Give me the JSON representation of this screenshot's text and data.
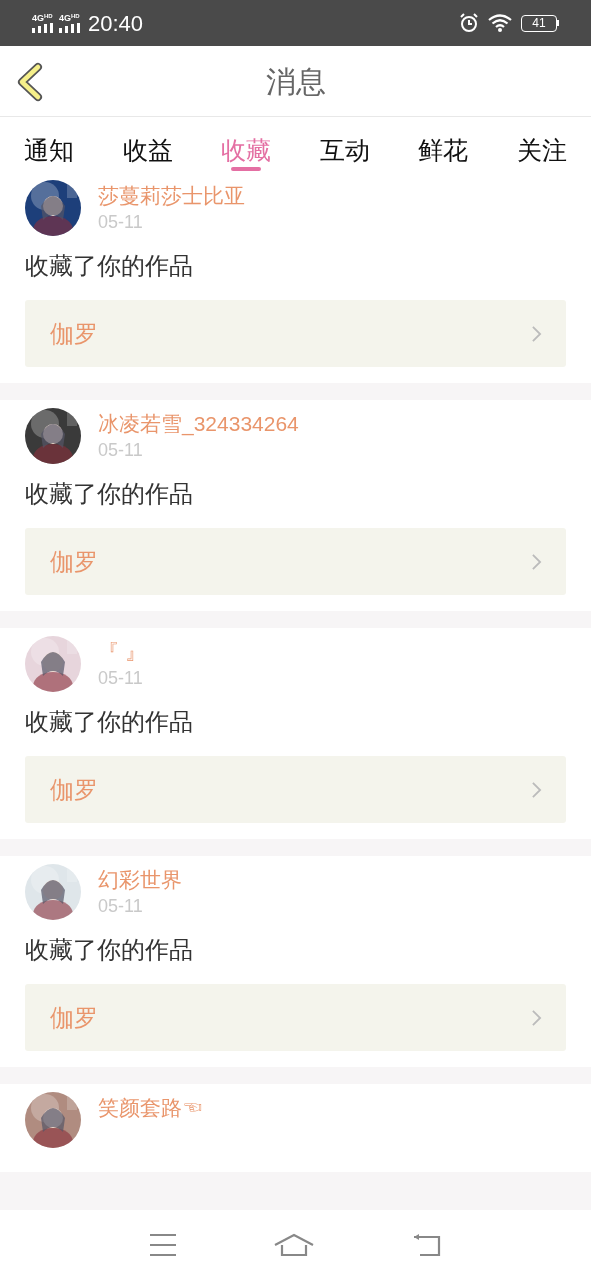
{
  "status_bar": {
    "network_1": "4G",
    "network_1_sup": "HD",
    "network_2": "4G",
    "network_2_sup": "HD",
    "time": "20:40",
    "battery": "41"
  },
  "header": {
    "title": "消息"
  },
  "tabs": [
    {
      "label": "通知",
      "selected": false
    },
    {
      "label": "收益",
      "selected": false
    },
    {
      "label": "收藏",
      "selected": true
    },
    {
      "label": "互动",
      "selected": false
    },
    {
      "label": "鲜花",
      "selected": false
    },
    {
      "label": "关注",
      "selected": false
    }
  ],
  "messages": [
    {
      "user": "莎蔓莉莎士比亚",
      "date": "05-11",
      "text": "收藏了你的作品",
      "work": "伽罗"
    },
    {
      "user": "冰凌若雪_324334264",
      "date": "05-11",
      "text": "收藏了你的作品",
      "work": "伽罗"
    },
    {
      "user": "『 』",
      "date": "05-11",
      "text": "收藏了你的作品",
      "work": "伽罗"
    },
    {
      "user": "幻彩世界",
      "date": "05-11",
      "text": "收藏了你的作品",
      "work": "伽罗"
    },
    {
      "user": "笑颜套路☜"
    }
  ]
}
